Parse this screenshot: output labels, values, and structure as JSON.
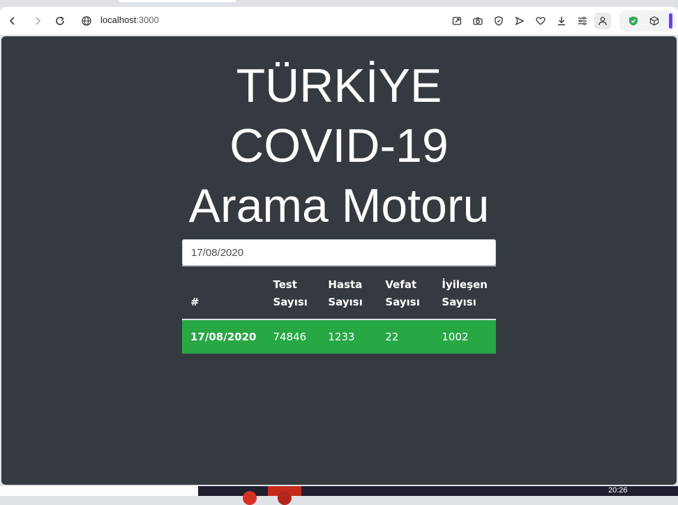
{
  "browser": {
    "url_host": "localhost",
    "url_port": ":3000"
  },
  "page": {
    "title_lines": [
      "TÜRKİYE",
      "COVID-19",
      "Arama Motoru"
    ],
    "date_input_value": "17/08/2020",
    "table": {
      "headers": [
        "#",
        "Test\nSayısı",
        "Hasta\nSayısı",
        "Vefat\nSayısı",
        "İyileşen\nSayısı"
      ],
      "rows": [
        [
          "17/08/2020",
          "74846",
          "1233",
          "22",
          "1002"
        ]
      ]
    }
  },
  "colors": {
    "page_background": "#343a40",
    "row_highlight": "#28a745"
  },
  "taskbar": {
    "clock": "20:26"
  }
}
